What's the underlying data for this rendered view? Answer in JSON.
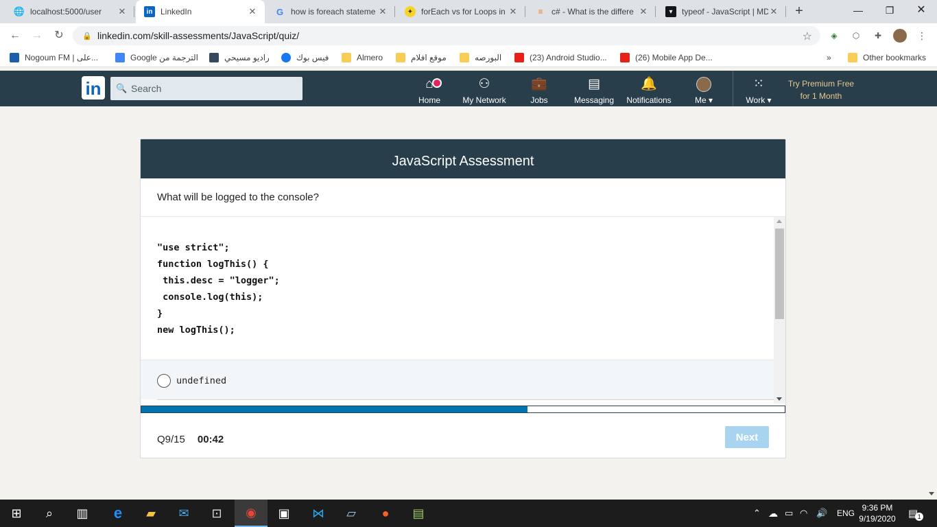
{
  "browser": {
    "tabs": [
      {
        "title": "localhost:5000/user",
        "favicon": "globe-icon"
      },
      {
        "title": "LinkedIn",
        "favicon": "linkedin-icon"
      },
      {
        "title": "how is foreach stateme",
        "favicon": "google-icon"
      },
      {
        "title": "forEach vs for Loops in",
        "favicon": "ts-icon"
      },
      {
        "title": "c# - What is the differe",
        "favicon": "stackoverflow-icon"
      },
      {
        "title": "typeof - JavaScript | MD",
        "favicon": "mdn-icon"
      }
    ],
    "url": "linkedin.com/skill-assessments/JavaScript/quiz/",
    "bookmarks": [
      "Nogoum FM | على...",
      "Google الترجمة من",
      "راديو مسيحي",
      "فيس بوك",
      "Almero",
      "موقع افلام",
      "البورصه",
      "(23) Android Studio...",
      "(26) Mobile App De..."
    ],
    "other_bookmarks": "Other bookmarks",
    "more_bookmarks": "»"
  },
  "linkedin_nav": {
    "logo": "in",
    "search_placeholder": "Search",
    "items": [
      {
        "label": "Home",
        "icon": "home-icon"
      },
      {
        "label": "My Network",
        "icon": "network-icon"
      },
      {
        "label": "Jobs",
        "icon": "briefcase-icon"
      },
      {
        "label": "Messaging",
        "icon": "messaging-icon"
      },
      {
        "label": "Notifications",
        "icon": "bell-icon"
      },
      {
        "label": "Me",
        "icon": "avatar"
      },
      {
        "label": "Work",
        "icon": "grid-icon"
      }
    ],
    "premium_line1": "Try Premium Free",
    "premium_line2": "for 1 Month"
  },
  "assessment": {
    "title": "JavaScript Assessment",
    "question": "What will be logged to the console?",
    "code": "\"use strict\";\nfunction logThis() {\n this.desc = \"logger\";\n console.log(this);\n}\nnew logThis();",
    "options": [
      "undefined"
    ],
    "progress": 0.6,
    "question_counter": "Q9/15",
    "timer": "00:42",
    "next_label": "Next"
  },
  "taskbar": {
    "language": "ENG",
    "time": "9:36 PM",
    "date": "9/19/2020",
    "notification_count": "1"
  },
  "colors": {
    "linkedin_nav": "#283e4a",
    "linkedin_blue": "#0073b1",
    "premium_gold": "#e8c98f",
    "next_disabled": "#a8d4f0"
  }
}
